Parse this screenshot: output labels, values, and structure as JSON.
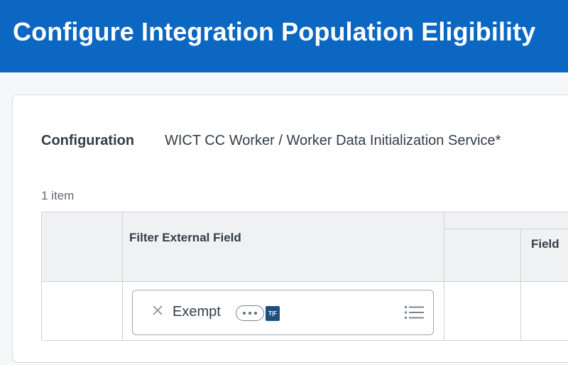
{
  "header": {
    "title": "Configure Integration Population Eligibility",
    "background_color": "#0b67c2"
  },
  "form": {
    "configuration_label": "Configuration",
    "configuration_value": "WICT CC Worker / Worker Data Initialization Service*"
  },
  "grid": {
    "item_count": "1 item",
    "columns": [
      {
        "title": ""
      },
      {
        "title": "Filter External Field"
      },
      {
        "title": ""
      },
      {
        "title": "Field"
      }
    ],
    "rows": [
      {
        "filter_external_field": {
          "value": "Exempt",
          "remove_icon": "close-icon",
          "more_icon": "ellipsis-icon",
          "type_badge": "T|F",
          "prompt_icon": "list-icon"
        }
      }
    ]
  }
}
